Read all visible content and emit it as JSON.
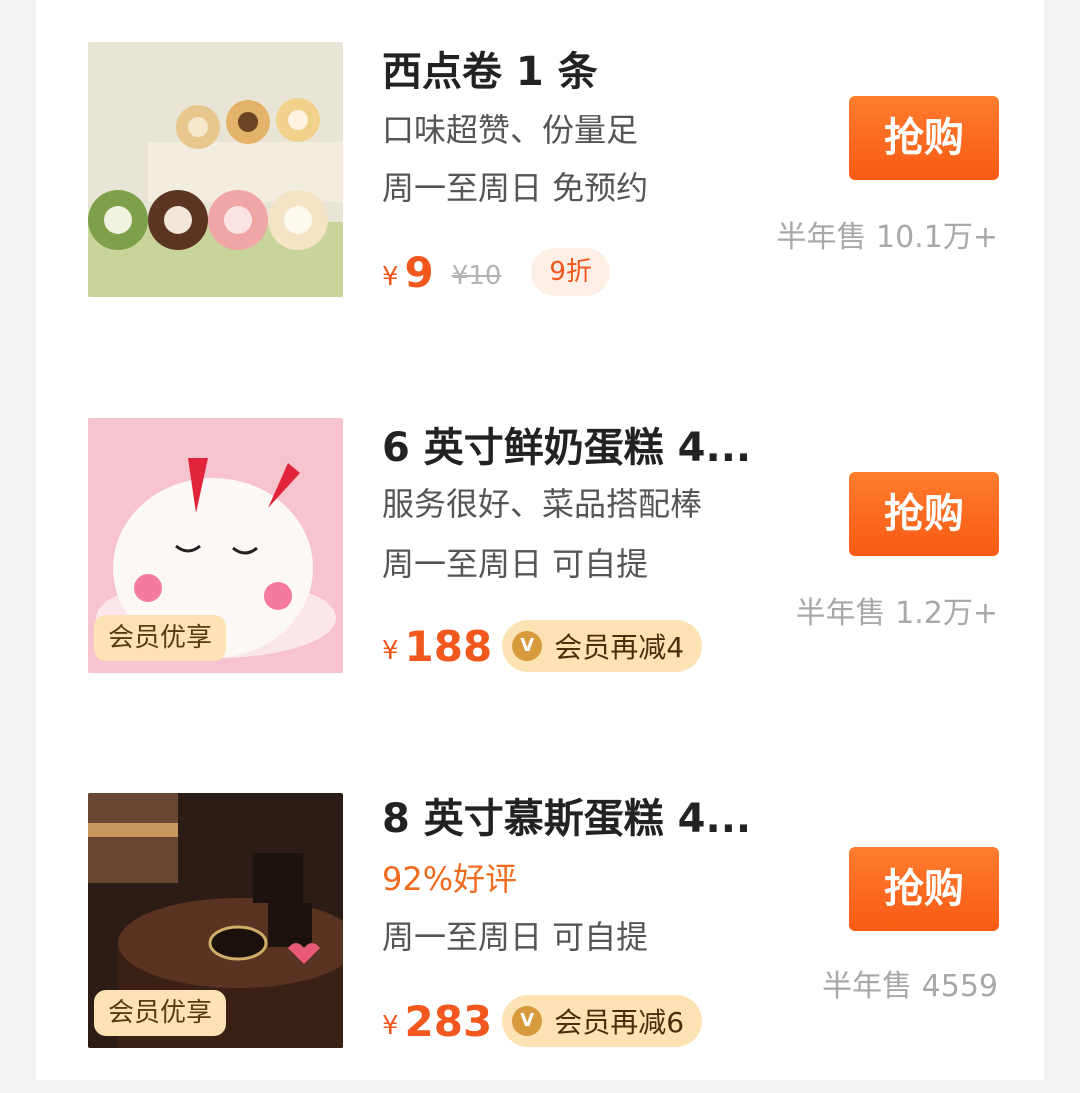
{
  "items": [
    {
      "title": "西点卷 1 条",
      "tagline": "口味超赞、份量足",
      "availability": "周一至周日  免预约",
      "currency": "¥",
      "price": "9",
      "original_price": "¥10",
      "discount": "9折",
      "buy_label": "抢购",
      "sales": "半年售 10.1万+"
    },
    {
      "title": "6 英寸鲜奶蛋糕 4...",
      "tagline": "服务很好、菜品搭配棒",
      "availability": "周一至周日  可自提",
      "currency": "¥",
      "price": "188",
      "member_badge": "会员优享",
      "vip_offer": "会员再减4",
      "buy_label": "抢购",
      "sales": "半年售 1.2万+"
    },
    {
      "title": "8 英寸慕斯蛋糕 4...",
      "tagline": "92%好评",
      "availability": "周一至周日  可自提",
      "currency": "¥",
      "price": "283",
      "member_badge": "会员优享",
      "vip_offer": "会员再减6",
      "buy_label": "抢购",
      "sales": "半年售 4559"
    }
  ],
  "colors": {
    "accent": "#f2581e",
    "vip_bg": "#fde3b4"
  },
  "icons": {
    "vip": "v-badge-icon"
  }
}
